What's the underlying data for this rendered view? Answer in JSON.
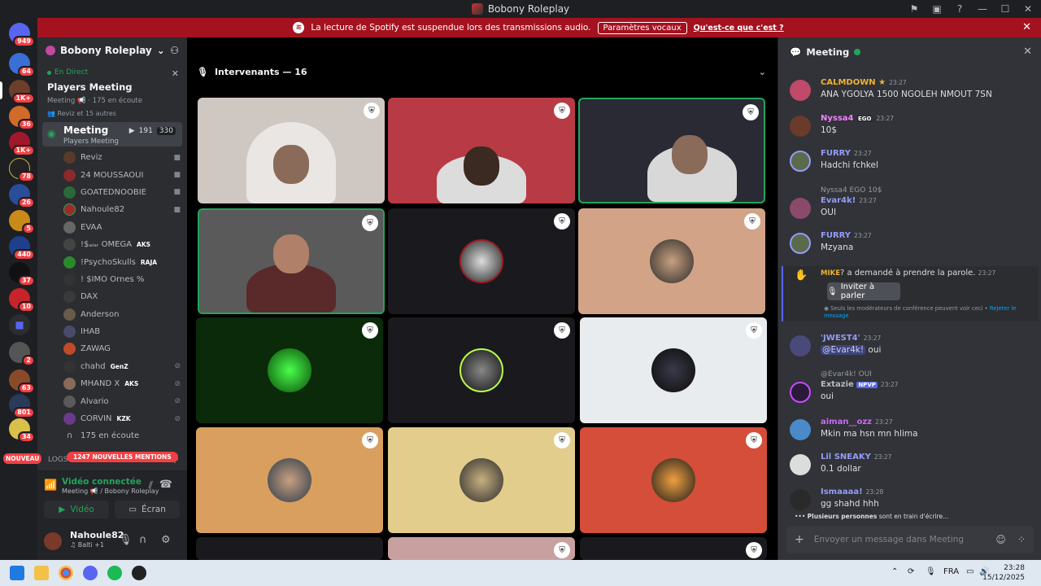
{
  "window": {
    "title": "Bobony Roleplay"
  },
  "notice": {
    "text": "La lecture de Spotify est suspendue lors des transmissions audio.",
    "button": "Paramètres vocaux",
    "link": "Qu'est-ce que c'est ?"
  },
  "rail": {
    "badges": [
      "949",
      "64",
      "1K+",
      "36",
      "1K+",
      "78",
      "26",
      "5",
      "440",
      "37",
      "10",
      "2",
      "63",
      "801",
      "34"
    ],
    "new_label": "NOUVEAU"
  },
  "server": {
    "name": "Bobony Roleplay",
    "live": "En Direct",
    "event_title": "Players Meeting",
    "event_meta": "Meeting",
    "listeners": "175 en écoute",
    "speakers_note": "Reviz et 15 autres",
    "channel": {
      "name": "Meeting",
      "sub": "Players Meeting",
      "count1": "191",
      "count2": "330"
    },
    "members": [
      {
        "name": "Reviz",
        "tag": ""
      },
      {
        "name": "24 MOUSSAOUI",
        "tag": ""
      },
      {
        "name": "GOATEDNOOBIE",
        "tag": ""
      },
      {
        "name": "Nahoule82",
        "tag": ""
      },
      {
        "name": "EVAA",
        "tag": ""
      },
      {
        "name": "!$ₐₗₐᵣ OMEGA",
        "tag": "AKS"
      },
      {
        "name": "!PsychoSkulls",
        "tag": "RAJA"
      },
      {
        "name": "! $IMO Ornes %",
        "tag": ""
      },
      {
        "name": "DAX",
        "tag": ""
      },
      {
        "name": "Anderson",
        "tag": ""
      },
      {
        "name": "IHAB",
        "tag": ""
      },
      {
        "name": "ZAWAG",
        "tag": ""
      },
      {
        "name": "chahd",
        "tag": "GenZ"
      },
      {
        "name": "MHAND X",
        "tag": "AKS"
      },
      {
        "name": "Alvario",
        "tag": ""
      },
      {
        "name": "CORVIN",
        "tag": "KZK"
      }
    ],
    "listening_label": "175 en écoute",
    "logs_label": "LOGS",
    "mentions_label": "1247 NOUVELLES MENTIONS"
  },
  "voice": {
    "status": "Vidéo connectée",
    "location": "Meeting",
    "server": "/ Bobony Roleplay",
    "video_label": "Vidéo",
    "screen_label": "Écran"
  },
  "user": {
    "name": "Nahoule82",
    "status": "Balti +1"
  },
  "stage": {
    "speakers_label": "Intervenants — 16"
  },
  "chat": {
    "title": "Meeting",
    "messages": [
      {
        "name": "CALMDOWN",
        "time": "23:27",
        "text": "ANA YGOLYA 1500 NGOLEH NMOUT 7SN",
        "color": "#f0b232"
      },
      {
        "name": "Nyssa4",
        "badge": "EGO",
        "time": "23:27",
        "text": "10$",
        "color": "#f47fff"
      },
      {
        "name": "FURRY",
        "time": "23:27",
        "text": "Hadchi fchkel",
        "color": "#949cf7"
      },
      {
        "reply": "Nyssa4 EGO 10$",
        "name": "Evar4k!",
        "time": "23:27",
        "text": "OUI",
        "color": "#949cf7"
      },
      {
        "name": "FURRY",
        "time": "23:27",
        "text": "Mzyana",
        "color": "#949cf7"
      },
      {
        "name": "'JWEST4'",
        "time": "23:27",
        "mention": "@Evar4k!",
        "text": "oui",
        "color": "#949cf7"
      },
      {
        "reply": "@Evar4k! OUI",
        "name": "Extazie",
        "badge": "NPVP",
        "time": "23:27",
        "text": "oui",
        "color": "#b5bac1"
      },
      {
        "name": "aiman__ozz",
        "time": "23:27",
        "text": "Mkin ma hsn mn hlima",
        "color": "#c76bf0"
      },
      {
        "name": "Lil SNEAKY",
        "time": "23:27",
        "text": "0.1 dollar",
        "color": "#949cf7"
      },
      {
        "name": "Ismaaaa!",
        "time": "23:28",
        "text": "gg shahd hhh",
        "color": "#949cf7"
      }
    ],
    "hand_request": {
      "name": "MIKE",
      "text": "? a demandé à prendre la parole.",
      "time": "23:27",
      "button": "Inviter à parler",
      "note": "Seuls les modérateurs de conférence peuvent voir ceci •",
      "reject": "Rejeter le message"
    },
    "typing_bold": "Plusieurs personnes",
    "typing_rest": "sont en train d'écrire...",
    "input_placeholder": "Envoyer un message dans Meeting"
  },
  "taskbar": {
    "lang": "FRA",
    "time": "23:28",
    "date": "15/12/2025"
  }
}
